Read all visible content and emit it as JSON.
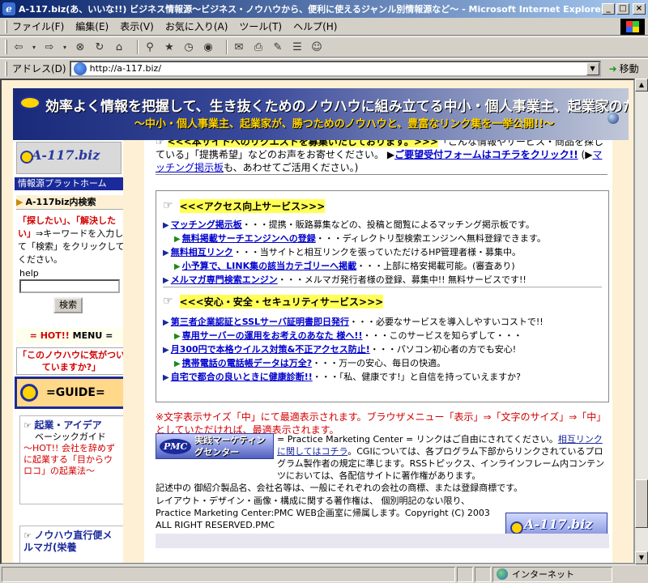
{
  "window": {
    "title": "A-117.biz(あ、いいな!!) ビジネス情報源〜ビジネス・ノウハウから、便利に使えるジャンル別情報源など〜 - Microsoft Internet Explorer",
    "btn_min": "_",
    "btn_max": "□",
    "btn_close": "×"
  },
  "menubar": {
    "items": [
      "ファイル(F)",
      "編集(E)",
      "表示(V)",
      "お気に入り(A)",
      "ツール(T)",
      "ヘルプ(H)"
    ]
  },
  "toolbar": {
    "icons": [
      "back-icon",
      "forward-icon",
      "stop-icon",
      "refresh-icon",
      "home-icon",
      "search-icon",
      "favorites-icon",
      "history-icon",
      "mail-icon",
      "print-icon",
      "edit-icon",
      "discuss-icon",
      "messenger-icon"
    ]
  },
  "address": {
    "label": "アドレス(D)",
    "url": "http://a-117.biz/",
    "go_label": "移動"
  },
  "status": {
    "zone": "インターネット"
  },
  "banner": {
    "line1": "効率よく情報を把握して、生き抜くためのノウハウに組み立てる中小・個人事業主、起業家のための新・情報入手ガイド",
    "line2": "〜中小・個人事業主、起業家が、勝つためのノウハウと、豊富なリンク集を一挙公開!!〜"
  },
  "left": {
    "logo": "A-117.biz",
    "nav_head": "情報源プラットホーム",
    "search_head": "A-117biz内検索",
    "text_red": "「探したい」、「解決したい」",
    "text_rest": "⇒キーワードを入力して「検索」をクリックしてください。",
    "help": "help",
    "search_button": "検索",
    "hot_red": "= HOT!!",
    "hot_menu": "MENU =",
    "notice": "「このノウハウに気がついていますか?」",
    "guide": "=GUIDE=",
    "idea_head": "起業・アイデア",
    "idea_sub": "ベーシックガイド",
    "idea_red": "〜HOT!! 会社を辞めずに起業する「目からウロコ」の起業法〜",
    "knowhow_head": "ノウハウ直行便メルマガ(栄養"
  },
  "main": {
    "top_hl": "<<<本サイトへのリクエストを募集いたしております。>>>",
    "top_text": "「こんな情報やサービス・商品を探している」「提携希望」などのお声をお寄せください。",
    "top_link": "ご要望受付フォームはコチラをクリック!!",
    "top_paren": "(",
    "top_link2": "マッチング掲示板",
    "top_paren_tail": "も、あわせてご活用ください。)",
    "sec1_head": "<<<アクセス向上サービス>>>",
    "sec1_items": [
      {
        "link": "マッチング掲示板",
        "text": "・・・提携・販路募集などの、投稿と閲覧によるマッチング掲示板です。",
        "sub": false
      },
      {
        "link": "無料掲載サーチエンジンへの登録",
        "text": "・・・ディレクトリ型検索エンジンへ無料登録できます。",
        "sub": true
      },
      {
        "link": "無料相互リンク",
        "text": "・・・当サイトと相互リンクを張っていただけるHP管理者様・募集中。",
        "sub": false
      },
      {
        "link": "小予算で、LINK集の該当カテゴリーへ掲載",
        "text": "・・・上部に格安掲載可能。(審査あり)",
        "sub": true
      },
      {
        "link": "メルマガ専門検索エンジン",
        "text": "・・・メルマガ発行者様の登録、募集中!! 無料サービスです!!",
        "sub": false
      }
    ],
    "sec2_head": "<<<安心・安全・セキュリティサービス>>>",
    "sec2_items": [
      {
        "link": "第三者企業認証とSSLサーバ証明書即日発行",
        "text": "・・・必要なサービスを導入しやすいコストで!!",
        "sub": false
      },
      {
        "link": "専用サーバーの運用をお考えのあなた 様へ!!",
        "text": "・・・このサービスを知らずして・・・",
        "sub": true
      },
      {
        "link": "月300円で本格ウイルス対策&不正アクセス防止!",
        "text": "・・・パソコン初心者の方でも安心!",
        "sub": false
      },
      {
        "link": "携帯電話の電話帳データは万全?",
        "text": "・・・万一の安心、毎日の快適。",
        "sub": true
      },
      {
        "link": "自宅で都合の良いときに健康診断!!",
        "text": "・・・「私、健康です!」と自信を持っていえますか?",
        "sub": false
      }
    ],
    "red_note": "※文字表示サイズ「中」にて最適表示されます。ブラウザメニュー「表示」⇒「文字のサイズ」⇒「中」としていただければ、最適表示されます。",
    "pmc_logo": "PMC",
    "pmc_logo_text": "実践マーケティングセンター",
    "pmc_line": "= Practice Marketing Center = リンクはご自由にされてください。",
    "pmc_link": "相互リンクに関してはコチラ",
    "pmc_line_tail": "。CGIについては、各プログラム下部からリンクされているプログラム製作者の規定に準じます。RSSトピックス、インラインフレーム内コンテンツにおいては、各配信サイトに著作権があります。",
    "pmc_rest": "記述中の 御紹介製品名、会社名等は、一般にそれぞれの会社の商標、または登録商標です。",
    "pmc_copy": "レイアウト・デザイン・画像・構成に関する著作権は、 個別明記のない限り、Practice Marketing Center:PMC WEB企画室に帰属します。Copyright (C) 2003 ALL RIGHT RESERVED.PMC",
    "footer_logo": "A-117.biz"
  }
}
